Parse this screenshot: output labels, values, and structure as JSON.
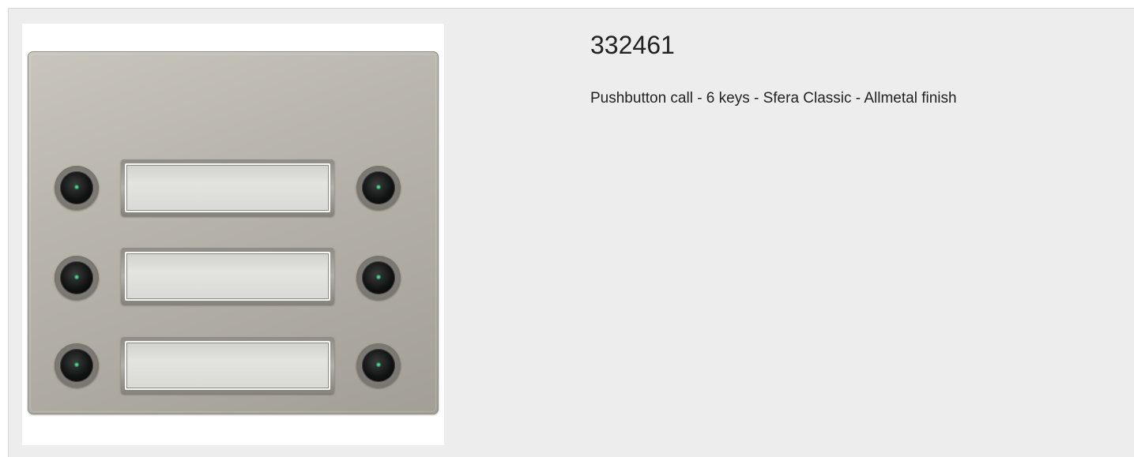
{
  "product": {
    "code": "332461",
    "description": "Pushbutton call - 6 keys - Sfera Classic - Allmetal finish"
  },
  "image": {
    "subject": "pushbutton-plate",
    "keys": 6,
    "label_slots": 3,
    "finish_color": "#b9b6ad",
    "led_color": "#3fbf74",
    "button_color": "#111313"
  }
}
